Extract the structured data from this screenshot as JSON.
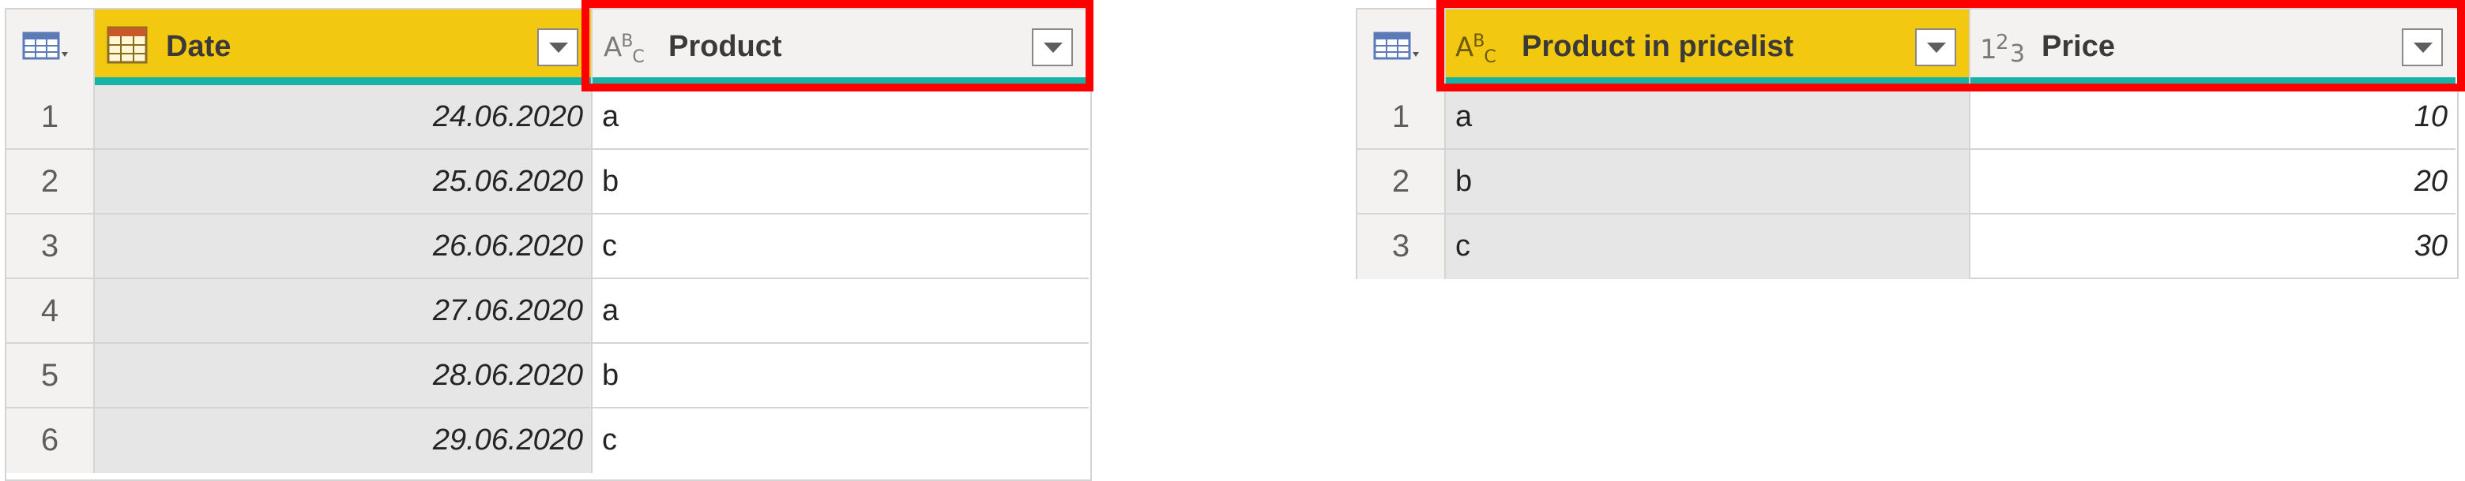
{
  "left_table": {
    "columns": [
      {
        "name": "Date",
        "type_icon": "calendar-icon",
        "selected": true
      },
      {
        "name": "Product",
        "type_icon": "text-type-icon",
        "type_label": "ABC",
        "selected": false
      }
    ],
    "rows": [
      {
        "index": "1",
        "date": "24.06.2020",
        "product": "a"
      },
      {
        "index": "2",
        "date": "25.06.2020",
        "product": "b"
      },
      {
        "index": "3",
        "date": "26.06.2020",
        "product": "c"
      },
      {
        "index": "4",
        "date": "27.06.2020",
        "product": "a"
      },
      {
        "index": "5",
        "date": "28.06.2020",
        "product": "b"
      },
      {
        "index": "6",
        "date": "29.06.2020",
        "product": "c"
      }
    ]
  },
  "right_table": {
    "columns": [
      {
        "name": "Product in pricelist",
        "type_icon": "text-type-icon",
        "type_label": "ABC",
        "selected": true
      },
      {
        "name": "Price",
        "type_icon": "number-type-icon",
        "type_label": "123",
        "selected": false
      }
    ],
    "rows": [
      {
        "index": "1",
        "product": "a",
        "price": "10"
      },
      {
        "index": "2",
        "product": "b",
        "price": "20"
      },
      {
        "index": "3",
        "product": "c",
        "price": "30"
      }
    ]
  },
  "colors": {
    "selected_header": "#f2c811",
    "header_accent": "#17b3a6",
    "highlight_box": "#ff0000",
    "selected_column": "#e6e6e6"
  }
}
